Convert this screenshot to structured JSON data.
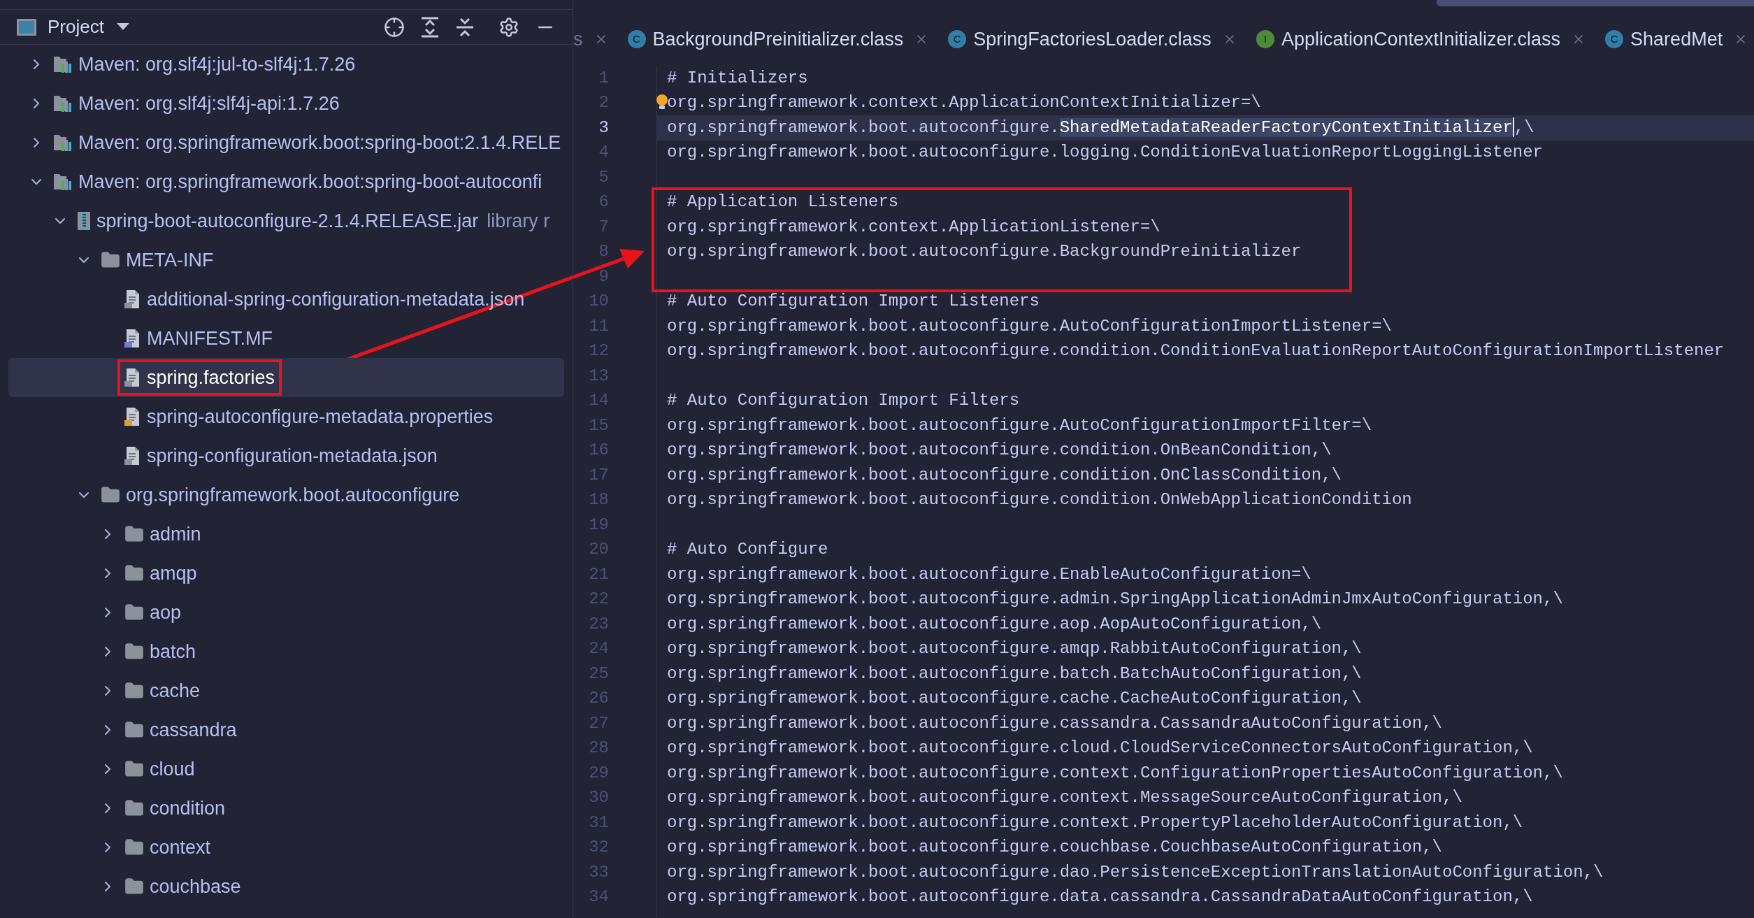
{
  "project_panel": {
    "title": "Project",
    "tree": [
      {
        "kind": "maven",
        "label": "Maven: org.slf4j:jul-to-slf4j:1.7.26",
        "expanded": false,
        "selected": false,
        "boxed": false
      },
      {
        "kind": "maven",
        "label": "Maven: org.slf4j:slf4j-api:1.7.26",
        "expanded": false,
        "selected": false,
        "boxed": false
      },
      {
        "kind": "maven",
        "label": "Maven: org.springframework.boot:spring-boot:2.1.4.RELE",
        "expanded": false,
        "selected": false,
        "boxed": false
      },
      {
        "kind": "maven",
        "label": "Maven: org.springframework.boot:spring-boot-autoconfi",
        "expanded": true,
        "selected": false,
        "boxed": false,
        "children": [
          {
            "kind": "jar",
            "label": "spring-boot-autoconfigure-2.1.4.RELEASE.jar",
            "note": "library r",
            "expanded": true,
            "selected": false,
            "boxed": false,
            "children": [
              {
                "kind": "folder",
                "label": "META-INF",
                "expanded": true,
                "selected": false,
                "boxed": false,
                "children": [
                  {
                    "kind": "json",
                    "label": "additional-spring-configuration-metadata.json",
                    "selected": false,
                    "boxed": false
                  },
                  {
                    "kind": "manifest",
                    "label": "MANIFEST.MF",
                    "selected": false,
                    "boxed": false
                  },
                  {
                    "kind": "text",
                    "label": "spring.factories",
                    "selected": true,
                    "boxed": true
                  },
                  {
                    "kind": "properties",
                    "label": "spring-autoconfigure-metadata.properties",
                    "selected": false,
                    "boxed": false
                  },
                  {
                    "kind": "json",
                    "label": "spring-configuration-metadata.json",
                    "selected": false,
                    "boxed": false
                  }
                ]
              },
              {
                "kind": "folder",
                "label": "org.springframework.boot.autoconfigure",
                "expanded": true,
                "selected": false,
                "boxed": false,
                "children": [
                  {
                    "kind": "folder",
                    "label": "admin",
                    "expanded": false,
                    "selected": false,
                    "boxed": false
                  },
                  {
                    "kind": "folder",
                    "label": "amqp",
                    "expanded": false,
                    "selected": false,
                    "boxed": false
                  },
                  {
                    "kind": "folder",
                    "label": "aop",
                    "expanded": false,
                    "selected": false,
                    "boxed": false
                  },
                  {
                    "kind": "folder",
                    "label": "batch",
                    "expanded": false,
                    "selected": false,
                    "boxed": false
                  },
                  {
                    "kind": "folder",
                    "label": "cache",
                    "expanded": false,
                    "selected": false,
                    "boxed": false
                  },
                  {
                    "kind": "folder",
                    "label": "cassandra",
                    "expanded": false,
                    "selected": false,
                    "boxed": false
                  },
                  {
                    "kind": "folder",
                    "label": "cloud",
                    "expanded": false,
                    "selected": false,
                    "boxed": false
                  },
                  {
                    "kind": "folder",
                    "label": "condition",
                    "expanded": false,
                    "selected": false,
                    "boxed": false
                  },
                  {
                    "kind": "folder",
                    "label": "context",
                    "expanded": false,
                    "selected": false,
                    "boxed": false
                  },
                  {
                    "kind": "folder",
                    "label": "couchbase",
                    "expanded": false,
                    "selected": false,
                    "boxed": false
                  }
                ]
              }
            ]
          }
        ]
      }
    ]
  },
  "editor": {
    "tabs": [
      {
        "kind": "none",
        "label": "s"
      },
      {
        "kind": "class",
        "badge": "C",
        "label": "BackgroundPreinitializer.class"
      },
      {
        "kind": "class",
        "badge": "C",
        "label": "SpringFactoriesLoader.class"
      },
      {
        "kind": "interface",
        "badge": "I",
        "label": "ApplicationContextInitializer.class"
      },
      {
        "kind": "class",
        "badge": "C",
        "label": "SharedMet"
      }
    ],
    "lines": [
      {
        "n": "1",
        "text": "# Initializers",
        "current": false,
        "boxed": false,
        "bulb": false
      },
      {
        "n": "2",
        "text": "org.springframework.context.ApplicationContextInitializer=\\",
        "current": false,
        "boxed": false,
        "bulb": true
      },
      {
        "n": "3",
        "text": "org.springframework.boot.autoconfigure.",
        "selection": "SharedMetadataReaderFactoryContextInitializer",
        "rest": ",\\",
        "current": true,
        "boxed": false,
        "bulb": false
      },
      {
        "n": "4",
        "text": "org.springframework.boot.autoconfigure.logging.ConditionEvaluationReportLoggingListener",
        "current": false,
        "boxed": false,
        "bulb": false
      },
      {
        "n": "5",
        "current": false,
        "boxed": false,
        "bulb": false
      },
      {
        "n": "6",
        "text": "# Application Listeners",
        "current": false,
        "boxed": true,
        "bulb": false
      },
      {
        "n": "7",
        "text": "org.springframework.context.ApplicationListener=\\",
        "current": false,
        "boxed": true,
        "bulb": false
      },
      {
        "n": "8",
        "text": "org.springframework.boot.autoconfigure.BackgroundPreinitializer",
        "current": false,
        "boxed": true,
        "bulb": false
      },
      {
        "n": "9",
        "current": false,
        "boxed": true,
        "bulb": false
      },
      {
        "n": "10",
        "text": "# Auto Configuration Import Listeners",
        "current": false,
        "boxed": false,
        "bulb": false
      },
      {
        "n": "11",
        "text": "org.springframework.boot.autoconfigure.AutoConfigurationImportListener=\\",
        "current": false,
        "boxed": false,
        "bulb": false
      },
      {
        "n": "12",
        "text": "org.springframework.boot.autoconfigure.condition.ConditionEvaluationReportAutoConfigurationImportListener",
        "current": false,
        "boxed": false,
        "bulb": false
      },
      {
        "n": "13",
        "current": false,
        "boxed": false,
        "bulb": false
      },
      {
        "n": "14",
        "text": "# Auto Configuration Import Filters",
        "current": false,
        "boxed": false,
        "bulb": false
      },
      {
        "n": "15",
        "text": "org.springframework.boot.autoconfigure.AutoConfigurationImportFilter=\\",
        "current": false,
        "boxed": false,
        "bulb": false
      },
      {
        "n": "16",
        "text": "org.springframework.boot.autoconfigure.condition.OnBeanCondition,\\",
        "current": false,
        "boxed": false,
        "bulb": false
      },
      {
        "n": "17",
        "text": "org.springframework.boot.autoconfigure.condition.OnClassCondition,\\",
        "current": false,
        "boxed": false,
        "bulb": false
      },
      {
        "n": "18",
        "text": "org.springframework.boot.autoconfigure.condition.OnWebApplicationCondition",
        "current": false,
        "boxed": false,
        "bulb": false
      },
      {
        "n": "19",
        "current": false,
        "boxed": false,
        "bulb": false
      },
      {
        "n": "20",
        "text": "# Auto Configure",
        "current": false,
        "boxed": false,
        "bulb": false
      },
      {
        "n": "21",
        "text": "org.springframework.boot.autoconfigure.EnableAutoConfiguration=\\",
        "current": false,
        "boxed": false,
        "bulb": false
      },
      {
        "n": "22",
        "text": "org.springframework.boot.autoconfigure.admin.SpringApplicationAdminJmxAutoConfiguration,\\",
        "current": false,
        "boxed": false,
        "bulb": false
      },
      {
        "n": "23",
        "text": "org.springframework.boot.autoconfigure.aop.AopAutoConfiguration,\\",
        "current": false,
        "boxed": false,
        "bulb": false
      },
      {
        "n": "24",
        "text": "org.springframework.boot.autoconfigure.amqp.RabbitAutoConfiguration,\\",
        "current": false,
        "boxed": false,
        "bulb": false
      },
      {
        "n": "25",
        "text": "org.springframework.boot.autoconfigure.batch.BatchAutoConfiguration,\\",
        "current": false,
        "boxed": false,
        "bulb": false
      },
      {
        "n": "26",
        "text": "org.springframework.boot.autoconfigure.cache.CacheAutoConfiguration,\\",
        "current": false,
        "boxed": false,
        "bulb": false
      },
      {
        "n": "27",
        "text": "org.springframework.boot.autoconfigure.cassandra.CassandraAutoConfiguration,\\",
        "current": false,
        "boxed": false,
        "bulb": false
      },
      {
        "n": "28",
        "text": "org.springframework.boot.autoconfigure.cloud.CloudServiceConnectorsAutoConfiguration,\\",
        "current": false,
        "boxed": false,
        "bulb": false
      },
      {
        "n": "29",
        "text": "org.springframework.boot.autoconfigure.context.ConfigurationPropertiesAutoConfiguration,\\",
        "current": false,
        "boxed": false,
        "bulb": false
      },
      {
        "n": "30",
        "text": "org.springframework.boot.autoconfigure.context.MessageSourceAutoConfiguration,\\",
        "current": false,
        "boxed": false,
        "bulb": false
      },
      {
        "n": "31",
        "text": "org.springframework.boot.autoconfigure.context.PropertyPlaceholderAutoConfiguration,\\",
        "current": false,
        "boxed": false,
        "bulb": false
      },
      {
        "n": "32",
        "text": "org.springframework.boot.autoconfigure.couchbase.CouchbaseAutoConfiguration,\\",
        "current": false,
        "boxed": false,
        "bulb": false
      },
      {
        "n": "33",
        "text": "org.springframework.boot.autoconfigure.dao.PersistenceExceptionTranslationAutoConfiguration,\\",
        "current": false,
        "boxed": false,
        "bulb": false
      },
      {
        "n": "34",
        "text": "org.springframework.boot.autoconfigure.data.cassandra.CassandraDataAutoConfiguration,\\",
        "current": false,
        "boxed": false,
        "bulb": false
      }
    ]
  }
}
